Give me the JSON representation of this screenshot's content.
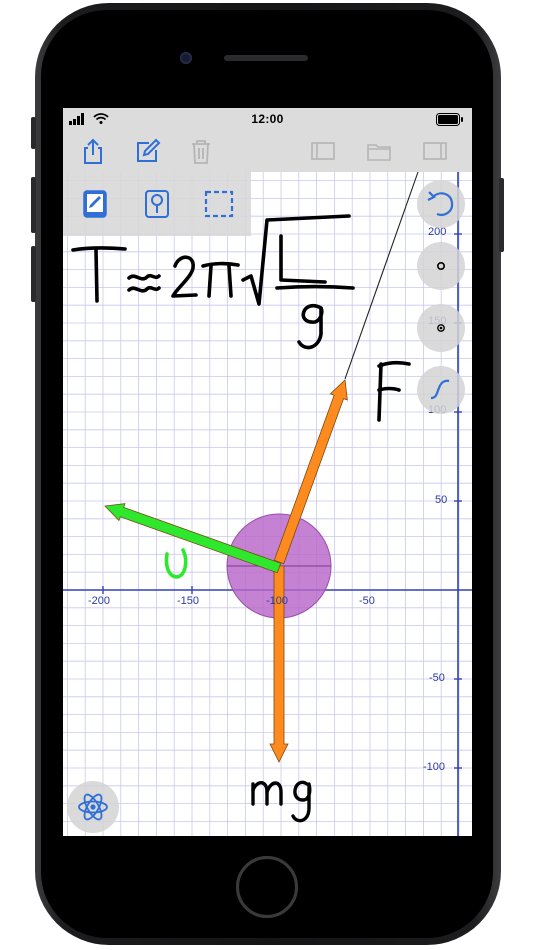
{
  "status_bar": {
    "time": "12:00"
  },
  "toolbar": {
    "buttons": [
      "share-icon",
      "compose-icon",
      "trash-icon",
      "page-view-icon",
      "folder-icon",
      "panel-icon"
    ],
    "accent_color": "#2f6fd6",
    "disabled_color": "#b5b5b5"
  },
  "tools": [
    "pen-tablet-icon",
    "magnifier-tool-icon",
    "selection-rect-icon"
  ],
  "side_controls": [
    "undo-icon",
    "point-icon",
    "point-circle-icon",
    "curve-icon"
  ],
  "graph": {
    "x_ticks": [
      "-200",
      "-150",
      "-100",
      "-50"
    ],
    "y_ticks": [
      "200",
      "150",
      "100",
      "50",
      "-50",
      "-100"
    ],
    "grid_color": "#c8c8ef",
    "axis_color": "#3340b8"
  },
  "annotations": {
    "formula": "T ≈ 2π √ L / g",
    "force_label": "F",
    "velocity_label": "υ",
    "weight_label": "mg"
  },
  "colors": {
    "mass": "#b866c8",
    "force_arrow": "#ff8a1e",
    "velocity_arrow": "#2ee82e"
  }
}
